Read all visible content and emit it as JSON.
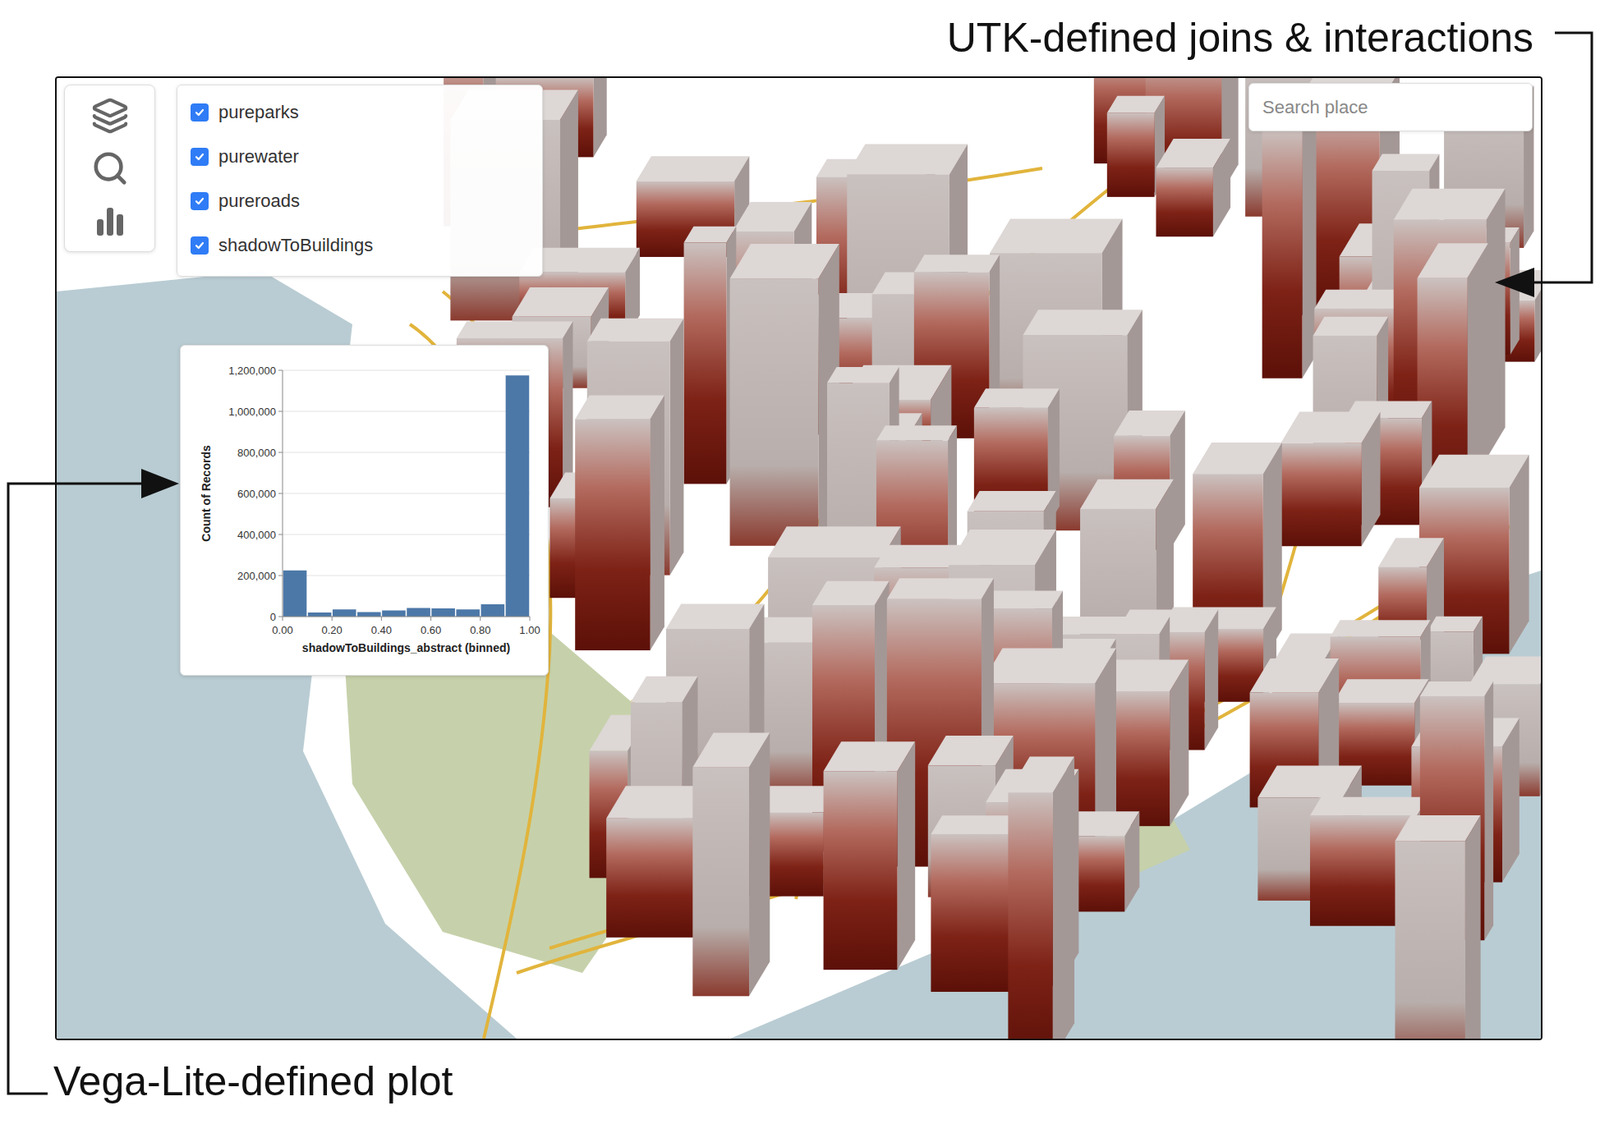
{
  "annotations": {
    "top": "UTK-defined joins & interactions",
    "bottom": "Vega-Lite-defined plot"
  },
  "layers": [
    {
      "label": "pureparks",
      "checked": true
    },
    {
      "label": "purewater",
      "checked": true
    },
    {
      "label": "pureroads",
      "checked": true
    },
    {
      "label": "shadowToBuildings",
      "checked": true
    }
  ],
  "search": {
    "placeholder": "Search place"
  },
  "chart": {
    "y_title": "Count of Records",
    "x_title": "shadowToBuildings_abstract (binned)",
    "y_ticks": [
      "0",
      "200,000",
      "400,000",
      "600,000",
      "800,000",
      "1,000,000",
      "1,200,000"
    ],
    "x_ticks": [
      "0.00",
      "0.20",
      "0.40",
      "0.60",
      "0.80",
      "1.00"
    ],
    "series": [
      {
        "name": "count",
        "color": "#4c78a8",
        "values": [
          225000,
          20000,
          35000,
          22000,
          30000,
          42000,
          40000,
          35000,
          60000,
          1175000
        ]
      }
    ]
  }
}
